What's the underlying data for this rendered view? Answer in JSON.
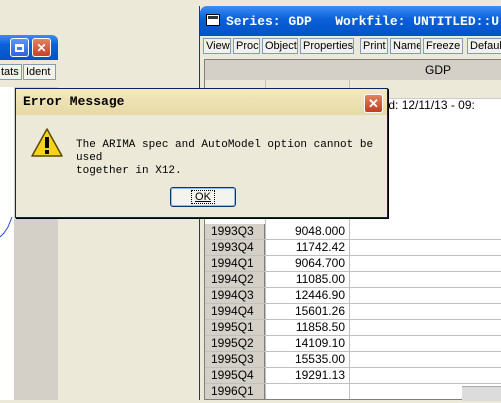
{
  "left_window": {
    "toolbar": [
      "tats",
      "Ident"
    ]
  },
  "series_window": {
    "title": "Series: GDP   Workfile: UNTITLED::U",
    "toolbar": [
      "View",
      "Proc",
      "Object",
      "Properties",
      "Print",
      "Name",
      "Freeze",
      "Defaul"
    ],
    "column_header": "GDP",
    "updated_text": "dated: 12/11/13 - 09:",
    "rows": [
      {
        "obs": "1993Q3",
        "value": "9048.000"
      },
      {
        "obs": "1993Q4",
        "value": "11742.42"
      },
      {
        "obs": "1994Q1",
        "value": "9064.700"
      },
      {
        "obs": "1994Q2",
        "value": "11085.00"
      },
      {
        "obs": "1994Q3",
        "value": "12446.90"
      },
      {
        "obs": "1994Q4",
        "value": "15601.26"
      },
      {
        "obs": "1995Q1",
        "value": "11858.50"
      },
      {
        "obs": "1995Q2",
        "value": "14109.10"
      },
      {
        "obs": "1995Q3",
        "value": "15535.00"
      },
      {
        "obs": "1995Q4",
        "value": "19291.13"
      },
      {
        "obs": "1996Q1",
        "value": ""
      }
    ]
  },
  "dialog": {
    "title": "Error Message",
    "message": "The ARIMA spec and AutoModel option cannot be used\ntogether in X12.",
    "ok_label": "OK",
    "icon": "warning-icon"
  }
}
